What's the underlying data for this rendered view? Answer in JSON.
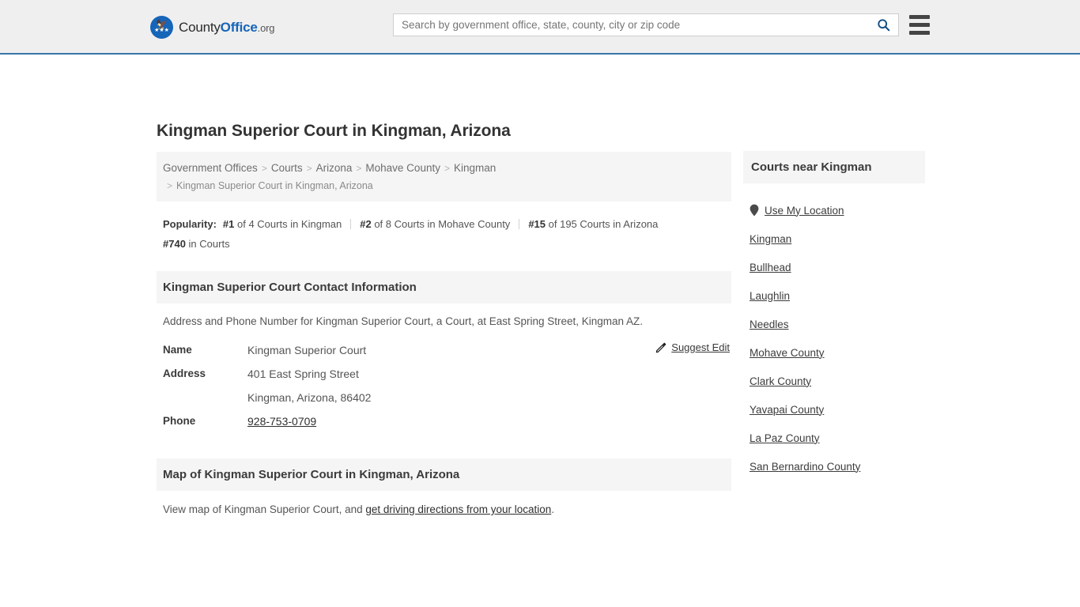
{
  "header": {
    "logo": {
      "part1": "County",
      "part2": "Office",
      "part3": ".org",
      "icon": "eagle-seal-icon"
    },
    "search": {
      "placeholder": "Search by government office, state, county, city or zip code",
      "value": "",
      "icon": "search-icon"
    },
    "menu_icon": "hamburger-menu-icon",
    "accent_color": "#3a76a8"
  },
  "main": {
    "title": "Kingman Superior Court in Kingman, Arizona",
    "breadcrumb": {
      "items": [
        "Government Offices",
        "Courts",
        "Arizona",
        "Mohave County",
        "Kingman"
      ],
      "separator": ">",
      "current": "Kingman Superior Court in Kingman, Arizona"
    },
    "popularity": {
      "label": "Popularity:",
      "items": [
        {
          "rank": "#1",
          "text": "of 4 Courts in Kingman"
        },
        {
          "rank": "#2",
          "text": "of 8 Courts in Mohave County"
        },
        {
          "rank": "#15",
          "text": "of 195 Courts in Arizona"
        },
        {
          "rank": "#740",
          "text": "in Courts"
        }
      ]
    },
    "contact": {
      "heading": "Kingman Superior Court Contact Information",
      "description": "Address and Phone Number for Kingman Superior Court, a Court, at East Spring Street, Kingman AZ.",
      "rows": [
        {
          "key": "Name",
          "value": "Kingman Superior Court",
          "link": false
        },
        {
          "key": "Address",
          "value": "401 East Spring Street",
          "link": false
        },
        {
          "key": "",
          "value": "Kingman, Arizona, 86402",
          "link": false
        },
        {
          "key": "Phone",
          "value": "928-753-0709",
          "link": true
        }
      ],
      "suggest_edit": {
        "label": "Suggest Edit",
        "icon": "edit-pencil-icon"
      }
    },
    "map": {
      "heading": "Map of Kingman Superior Court in Kingman, Arizona",
      "desc_before": "View map of Kingman Superior Court, and ",
      "desc_link": "get driving directions from your location",
      "desc_after": "."
    }
  },
  "sidebar": {
    "heading": "Courts near Kingman",
    "use_my_location": {
      "label": "Use My Location",
      "icon": "map-pin-icon"
    },
    "items": [
      {
        "label": "Kingman"
      },
      {
        "label": "Bullhead"
      },
      {
        "label": "Laughlin"
      },
      {
        "label": "Needles"
      },
      {
        "label": "Mohave County"
      },
      {
        "label": "Clark County"
      },
      {
        "label": "Yavapai County"
      },
      {
        "label": "La Paz County"
      },
      {
        "label": "San Bernardino County"
      }
    ]
  }
}
